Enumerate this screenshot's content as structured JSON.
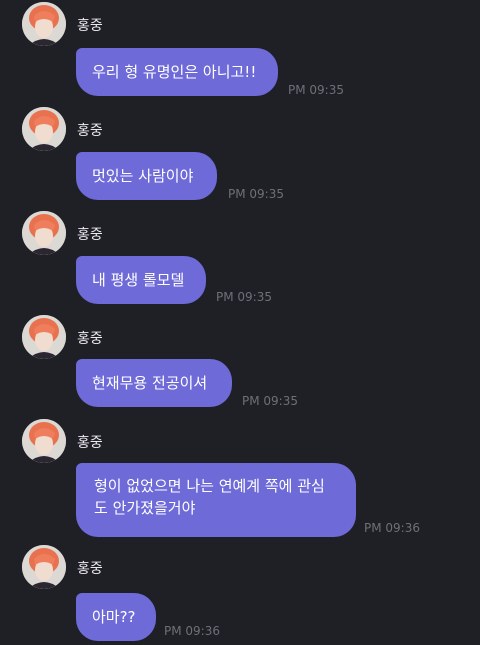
{
  "messages": [
    {
      "sender": "홍중",
      "text": "우리 형 유명인은 아니고!!",
      "time": "PM 09:35"
    },
    {
      "sender": "홍중",
      "text": "멋있는 사람이야",
      "time": "PM 09:35"
    },
    {
      "sender": "홍중",
      "text": "내 평생 롤모델",
      "time": "PM 09:35"
    },
    {
      "sender": "홍중",
      "text": "현재무용 전공이셔",
      "time": "PM 09:35"
    },
    {
      "sender": "홍중",
      "text": "형이 없었으면 나는 연예계 쪽에 관심도 안가졌을거야",
      "time": "PM 09:36"
    },
    {
      "sender": "홍중",
      "text": "아마??",
      "time": "PM 09:36"
    }
  ],
  "colors": {
    "background": "#1f1f26",
    "bubble": "#6e6ad7",
    "timestamp": "#6f6f78"
  },
  "icons": {
    "avatar": "profile-photo"
  }
}
